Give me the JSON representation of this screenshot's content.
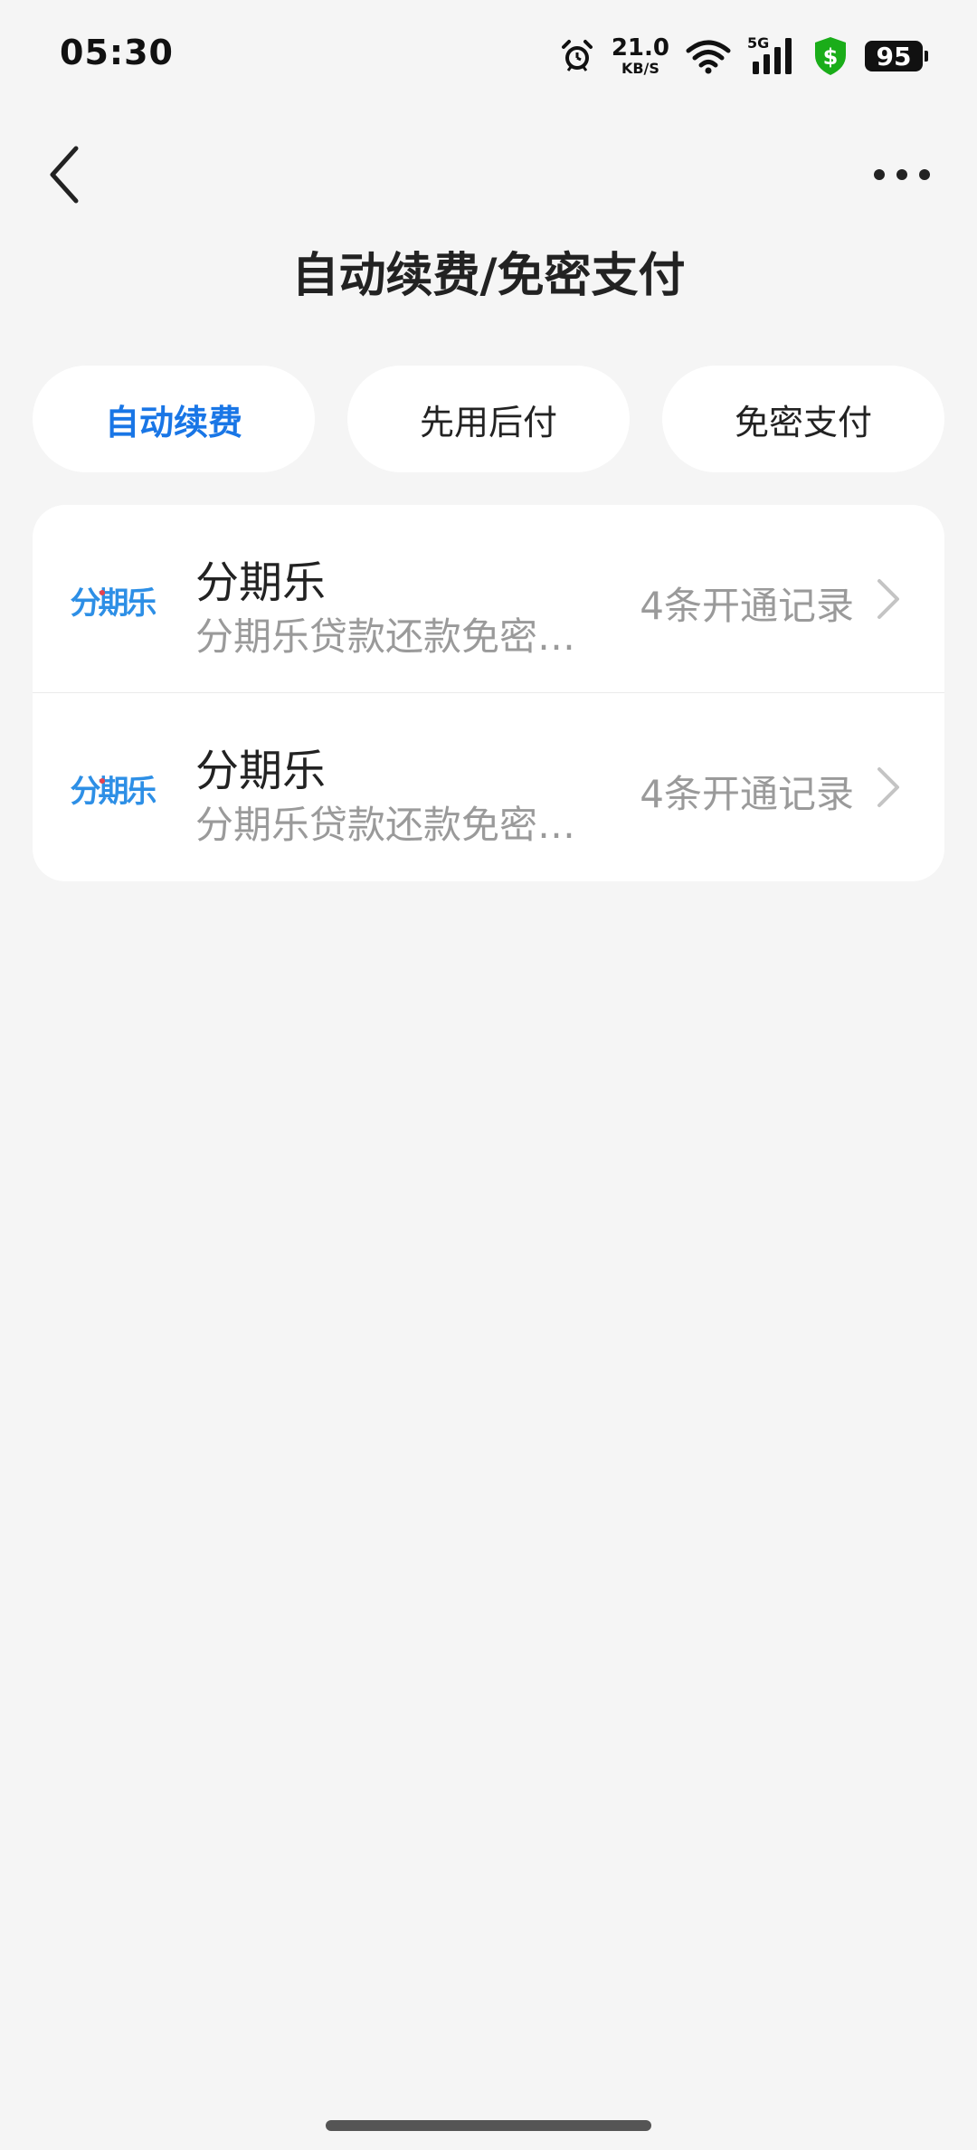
{
  "status_bar": {
    "time": "05:30",
    "net_speed": "21.0",
    "net_unit": "KB/S",
    "network_type": "5G",
    "battery": "95",
    "icons": [
      "alarm-icon",
      "wifi-icon",
      "signal-icon",
      "shield-dollar-icon",
      "battery-icon"
    ],
    "shield_color": "#1aad19"
  },
  "nav": {
    "title": "自动续费/免密支付",
    "back_icon": "chevron-left-icon",
    "more_icon": "more-dots-icon"
  },
  "tabs": [
    {
      "label": "自动续费",
      "active": true
    },
    {
      "label": "先用后付",
      "active": false
    },
    {
      "label": "免密支付",
      "active": false
    }
  ],
  "accent_color": "#1976e6",
  "list": {
    "items": [
      {
        "logo_text": "分期乐",
        "title": "分期乐",
        "subtitle": "分期乐贷款还款免密支付",
        "count": "4条开通记录"
      },
      {
        "logo_text": "分期乐",
        "title": "分期乐",
        "subtitle": "分期乐贷款还款免密支付",
        "count": "4条开通记录"
      }
    ]
  }
}
